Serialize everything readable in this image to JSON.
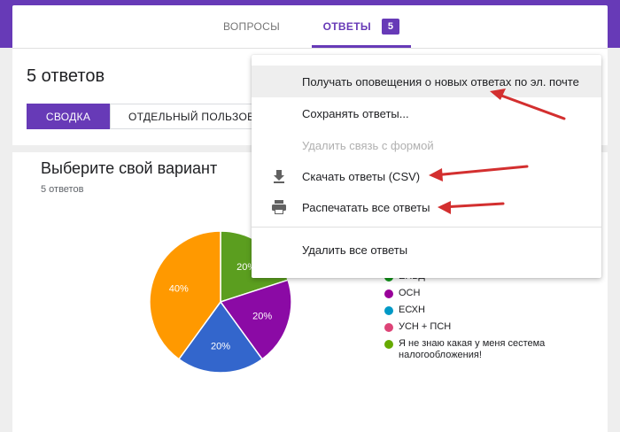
{
  "tabs": {
    "questions_label": "ВОПРОСЫ",
    "answers_label": "ОТВЕТЫ",
    "answers_count": "5"
  },
  "summary": {
    "responses_title": "5 ответов",
    "seg_summary": "СВОДКА",
    "seg_individual": "ОТДЕЛЬНЫЙ ПОЛЬЗОВАТЕЛЬ"
  },
  "question": {
    "title": "Выберите свой вариант",
    "subtitle": "5 ответов"
  },
  "chart_data": {
    "type": "pie",
    "title": "",
    "slices": [
      {
        "label": "ЕНВД",
        "value": 20,
        "color": "#5b9e1f",
        "text": "20%"
      },
      {
        "label": "ОСН",
        "value": 20,
        "color": "#8b0aa5",
        "text": "20%"
      },
      {
        "label": "ЕСХН",
        "value": 20,
        "color": "#3366cc",
        "text": "20%"
      },
      {
        "label": "Я не знаю какая у меня сестема налогообложения!",
        "value": 40,
        "color": "#ff9900",
        "text": "40%"
      }
    ],
    "legend": [
      {
        "label": "ЕНВД",
        "color": "#109618"
      },
      {
        "label": "ОСН",
        "color": "#990099"
      },
      {
        "label": "ЕСХН",
        "color": "#0099c6"
      },
      {
        "label": "УСН + ПСН",
        "color": "#dd4477"
      },
      {
        "label": "Я не знаю какая у меня сестема налогообложения!",
        "color": "#66aa00"
      }
    ]
  },
  "menu": {
    "items": [
      {
        "label": "Получать оповещения о новых ответах по эл. почте",
        "icon": "",
        "state": "highlight"
      },
      {
        "label": "Сохранять ответы...",
        "icon": "",
        "state": "normal"
      },
      {
        "label": "Удалить связь с формой",
        "icon": "",
        "state": "disabled"
      },
      {
        "label": "Скачать ответы (CSV)",
        "icon": "download-icon",
        "state": "normal"
      },
      {
        "label": "Распечатать все ответы",
        "icon": "print-icon",
        "state": "normal"
      },
      {
        "label": "Удалить все ответы",
        "icon": "",
        "state": "normal"
      }
    ]
  },
  "colors": {
    "accent": "#673ab7",
    "arrow": "#d32f2f"
  }
}
